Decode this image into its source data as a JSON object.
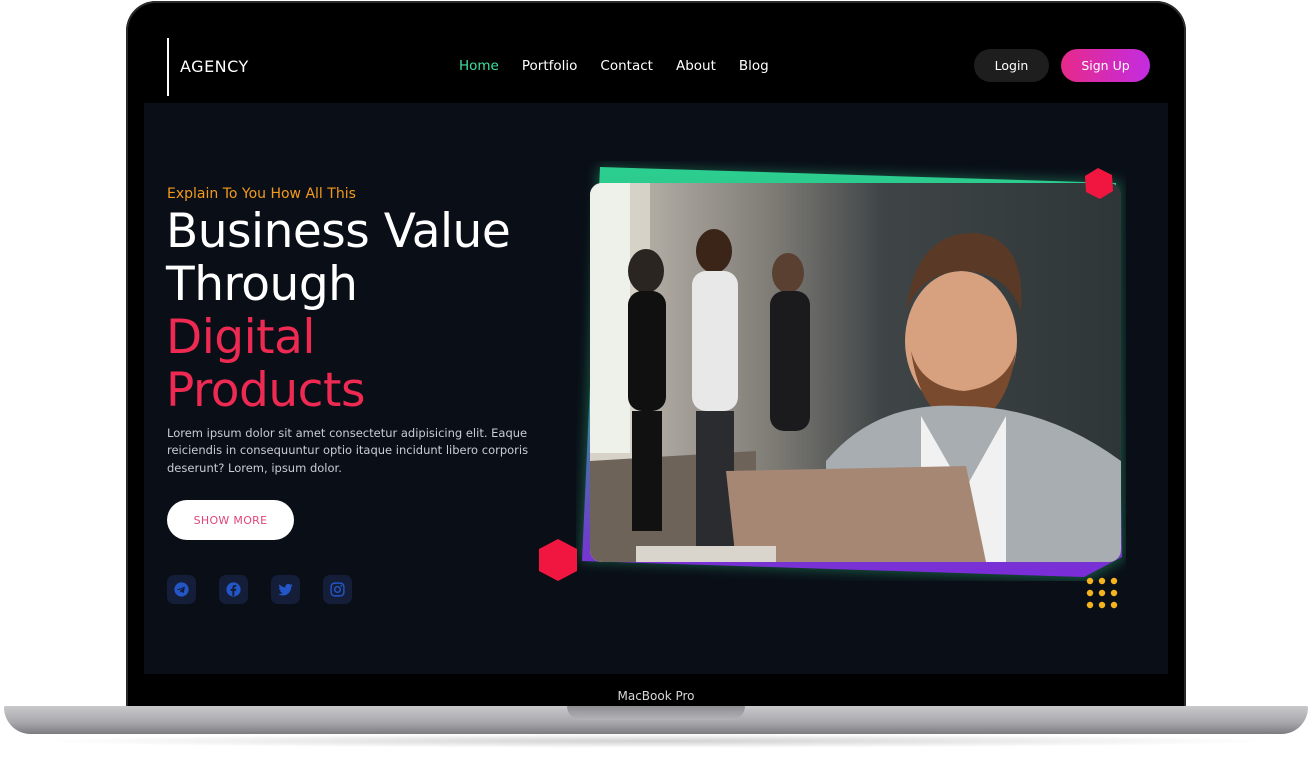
{
  "device": {
    "label": "MacBook Pro"
  },
  "nav": {
    "logo": "AGENCY",
    "links": [
      "Home",
      "Portfolio",
      "Contact",
      "About",
      "Blog"
    ],
    "active_link": "Home",
    "login": "Login",
    "signup": "Sign Up"
  },
  "hero": {
    "eyebrow": "Explain To You How All This",
    "headline_line1": "Business Value",
    "headline_line2": "Through",
    "headline_line3": "Digital",
    "headline_line4": "Products",
    "description": "Lorem ipsum dolor sit amet consectetur adipisicing elit. Eaque reiciendis in consequuntur optio itaque incidunt libero corporis deserunt? Lorem, ipsum dolor.",
    "cta": "SHOW MORE"
  },
  "socials": [
    "telegram-icon",
    "facebook-icon",
    "twitter-icon",
    "instagram-icon"
  ],
  "colors": {
    "accent_green": "#3fe0a0",
    "accent_red": "#ee2a53",
    "accent_orange": "#f39a1c",
    "signup_gradient_start": "#e72a8a",
    "signup_gradient_end": "#c32ce0",
    "frame_purple": "#7d2bd9",
    "hexagon_red": "#f0163f",
    "dots_yellow": "#f5b41e",
    "background": "#0a0e17"
  }
}
